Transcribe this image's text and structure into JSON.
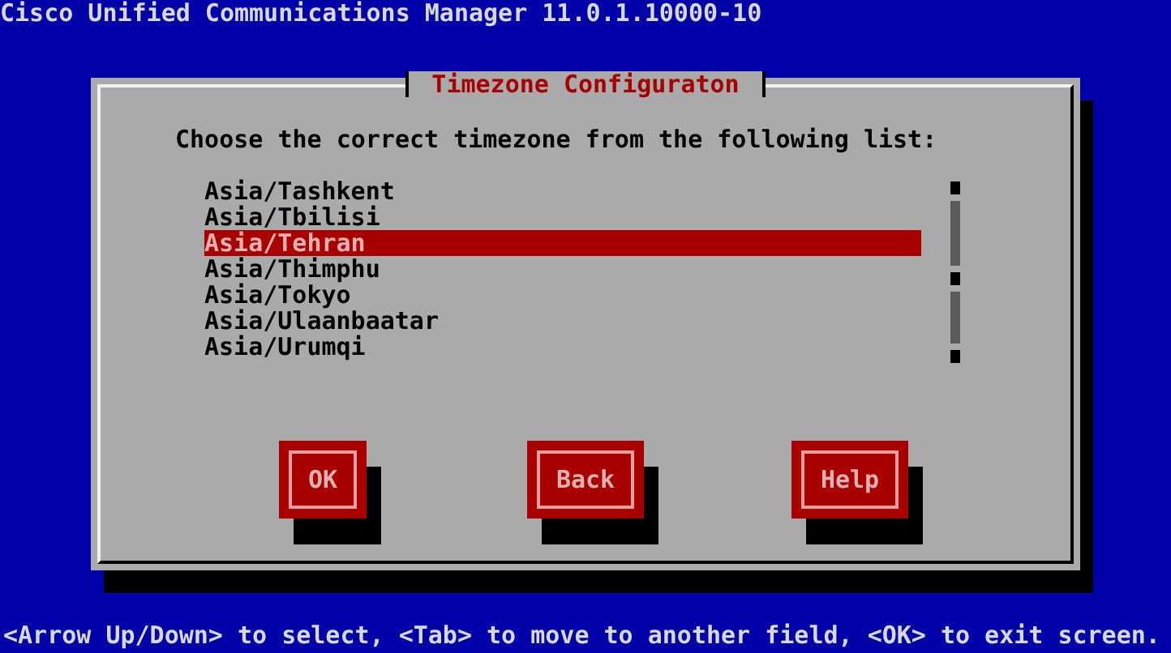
{
  "header": {
    "title": "Cisco Unified Communications Manager 11.0.1.10000-10"
  },
  "dialog": {
    "title": "Timezone Configuraton",
    "prompt": "Choose the correct timezone from the following list:",
    "items": [
      {
        "label": "Asia/Tashkent",
        "selected": false
      },
      {
        "label": "Asia/Tbilisi",
        "selected": false
      },
      {
        "label": "Asia/Tehran",
        "selected": true
      },
      {
        "label": "Asia/Thimphu",
        "selected": false
      },
      {
        "label": "Asia/Tokyo",
        "selected": false
      },
      {
        "label": "Asia/Ulaanbaatar",
        "selected": false
      },
      {
        "label": "Asia/Urumqi",
        "selected": false
      }
    ],
    "buttons": [
      "OK",
      "Back",
      "Help"
    ]
  },
  "status_bar": "<Arrow Up/Down> to select, <Tab> to move to another field, <OK> to exit screen."
}
